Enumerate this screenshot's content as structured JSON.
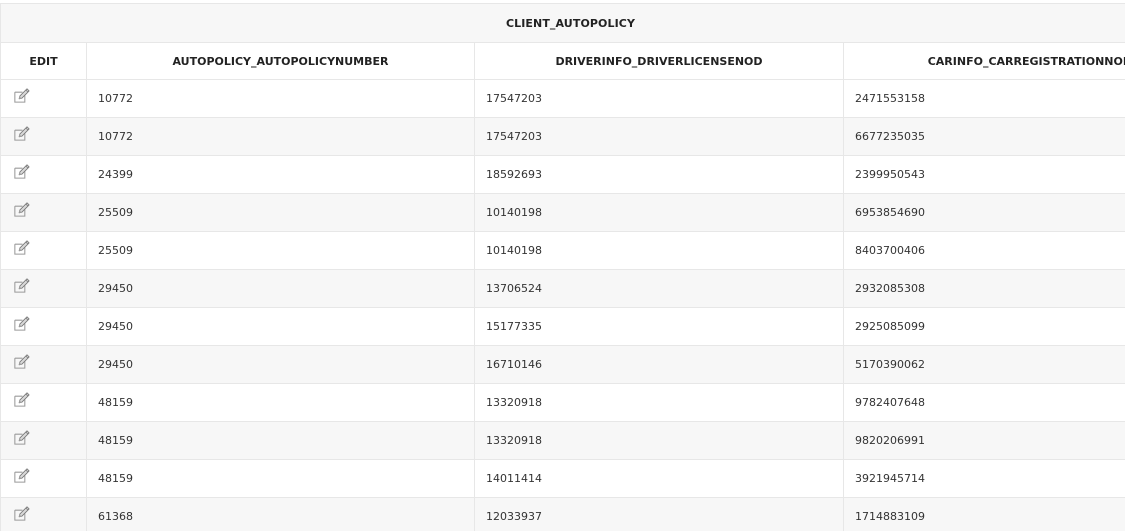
{
  "table": {
    "title": "CLIENT_AUTOPOLICY",
    "columns": [
      "EDIT",
      "AUTOPOLICY_AUTOPOLICYNUMBER",
      "DRIVERINFO_DRIVERLICENSENOD",
      "CARINFO_CARREGISTRATIONNOD"
    ],
    "edit_icon": "edit-pencil-icon",
    "rows": [
      {
        "policy": "10772",
        "license": "17547203",
        "car": "2471553158"
      },
      {
        "policy": "10772",
        "license": "17547203",
        "car": "6677235035"
      },
      {
        "policy": "24399",
        "license": "18592693",
        "car": "2399950543"
      },
      {
        "policy": "25509",
        "license": "10140198",
        "car": "6953854690"
      },
      {
        "policy": "25509",
        "license": "10140198",
        "car": "8403700406"
      },
      {
        "policy": "29450",
        "license": "13706524",
        "car": "2932085308"
      },
      {
        "policy": "29450",
        "license": "15177335",
        "car": "2925085099"
      },
      {
        "policy": "29450",
        "license": "16710146",
        "car": "5170390062"
      },
      {
        "policy": "48159",
        "license": "13320918",
        "car": "9782407648"
      },
      {
        "policy": "48159",
        "license": "13320918",
        "car": "9820206991"
      },
      {
        "policy": "48159",
        "license": "14011414",
        "car": "3921945714"
      },
      {
        "policy": "61368",
        "license": "12033937",
        "car": "1714883109"
      }
    ]
  }
}
